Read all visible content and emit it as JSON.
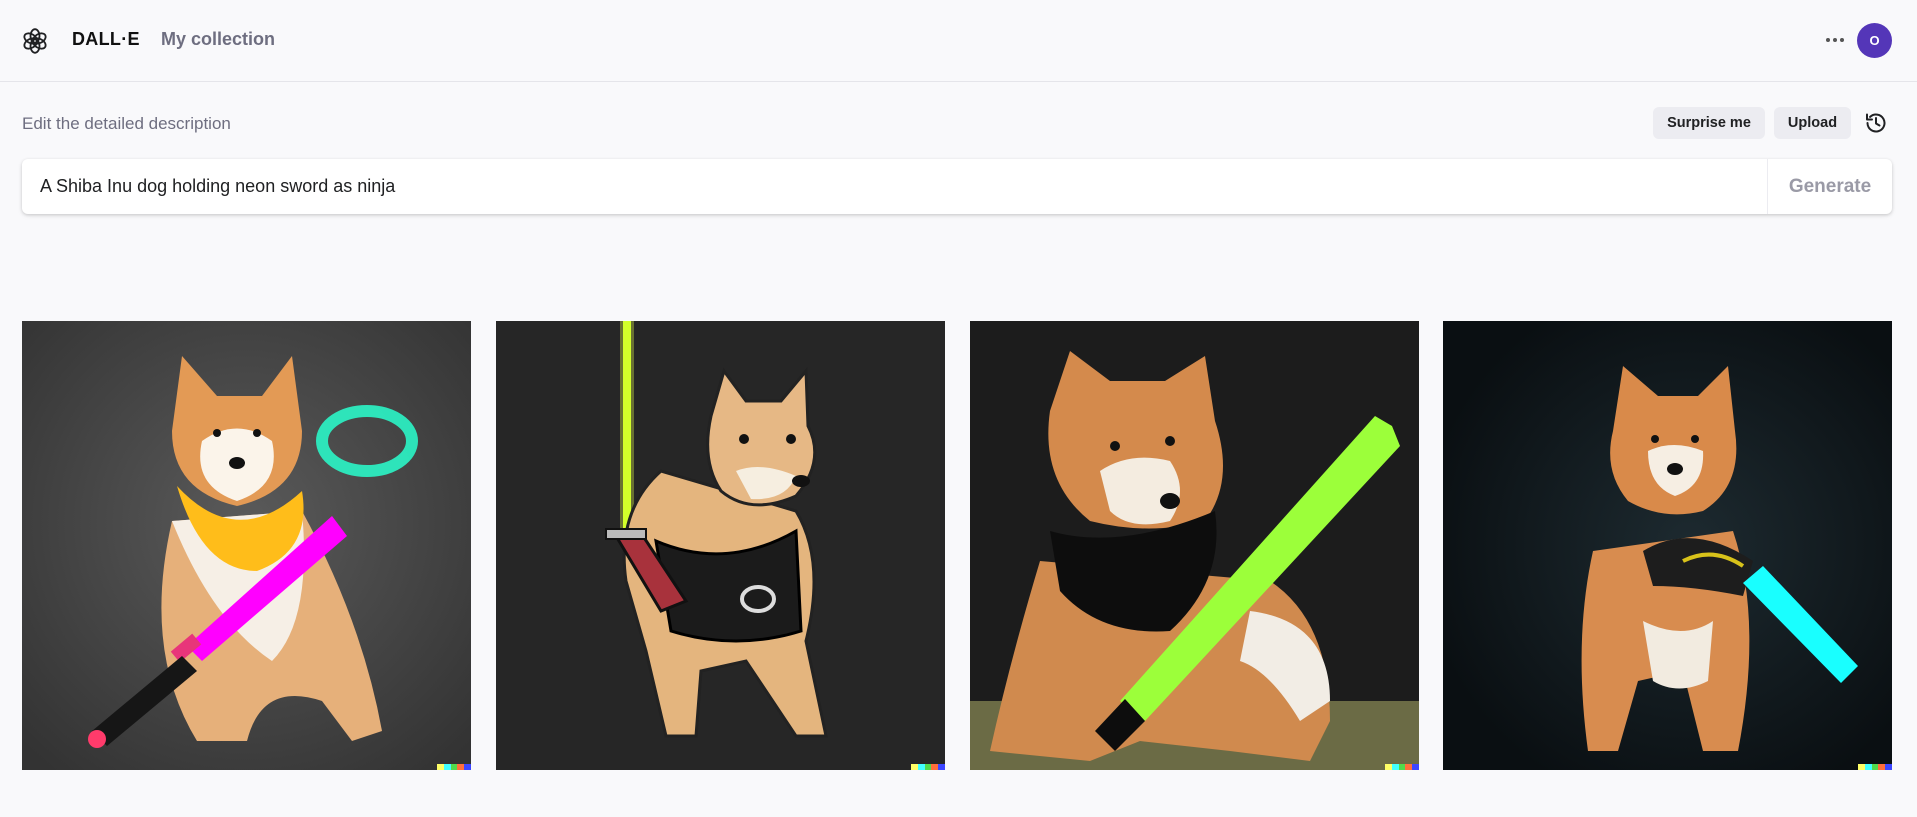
{
  "header": {
    "logo_icon": "openai-logo-icon",
    "brand": "DALL·E",
    "collection_link": "My collection",
    "more_icon": "more-horizontal-icon",
    "avatar_initial": "O",
    "avatar_color": "#5436b8"
  },
  "editor": {
    "label": "Edit the detailed description",
    "surprise_label": "Surprise me",
    "upload_label": "Upload",
    "history_icon": "history-icon",
    "prompt_value": "A Shiba Inu dog holding neon sword as ninja",
    "generate_label": "Generate"
  },
  "results": {
    "images": [
      {
        "alt": "Shiba Inu in yellow bandana holding magenta neon sword",
        "sword_color": "#ff00ff",
        "background": "#4a4a4a"
      },
      {
        "alt": "Cartoon Shiba Inu with black vest and yellow-green neon sword",
        "sword_color": "#c8ff1a",
        "background": "#262626"
      },
      {
        "alt": "Shiba Inu in black bib holding green neon sword",
        "sword_color": "#9cff3a",
        "background": "#1a1a1a"
      },
      {
        "alt": "Shiba Inu standing with cyan neon sword",
        "sword_color": "#19ffff",
        "background": "#0d1418"
      }
    ],
    "signature_colors": [
      "#ffff66",
      "#42ffff",
      "#51da4c",
      "#ff6e3c",
      "#3c46ff"
    ]
  }
}
